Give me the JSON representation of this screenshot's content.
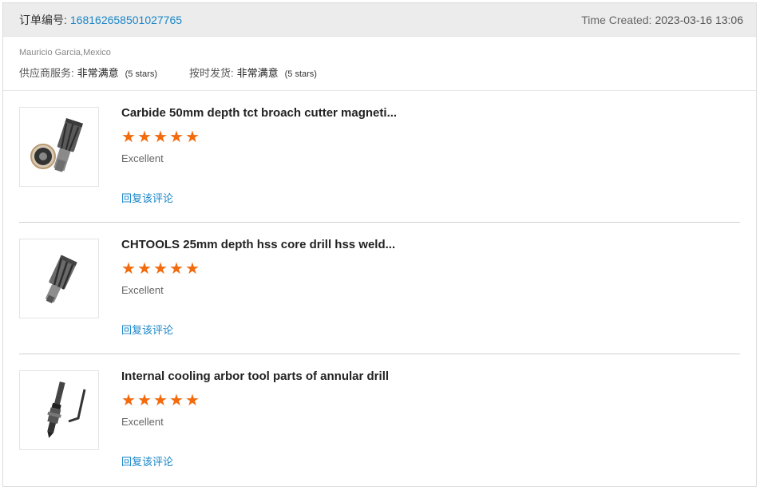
{
  "header": {
    "order_label": "订单编号:",
    "order_number": "168162658501027765",
    "time_label": "Time Created:",
    "time_value": "2023-03-16 13:06"
  },
  "buyer": "Mauricio Garcia,Mexico",
  "ratings": [
    {
      "label": "供应商服务:",
      "value": "非常满意",
      "stars": "(5 stars)"
    },
    {
      "label": "按时发货:",
      "value": "非常满意",
      "stars": "(5 stars)"
    }
  ],
  "products": [
    {
      "title": "Carbide 50mm depth tct broach cutter magneti...",
      "rating": 5,
      "comment": "Excellent",
      "reply_label": "回复该评论",
      "image_icon": "annular-cutter-image"
    },
    {
      "title": "CHTOOLS 25mm depth hss core drill hss weld...",
      "rating": 5,
      "comment": "Excellent",
      "reply_label": "回复该评论",
      "image_icon": "core-drill-image"
    },
    {
      "title": "Internal cooling arbor tool parts of annular drill",
      "rating": 5,
      "comment": "Excellent",
      "reply_label": "回复该评论",
      "image_icon": "arbor-tool-image"
    }
  ],
  "colors": {
    "accent": "#1a86c8",
    "star": "#f26b0f",
    "header_bg": "#ececec"
  }
}
